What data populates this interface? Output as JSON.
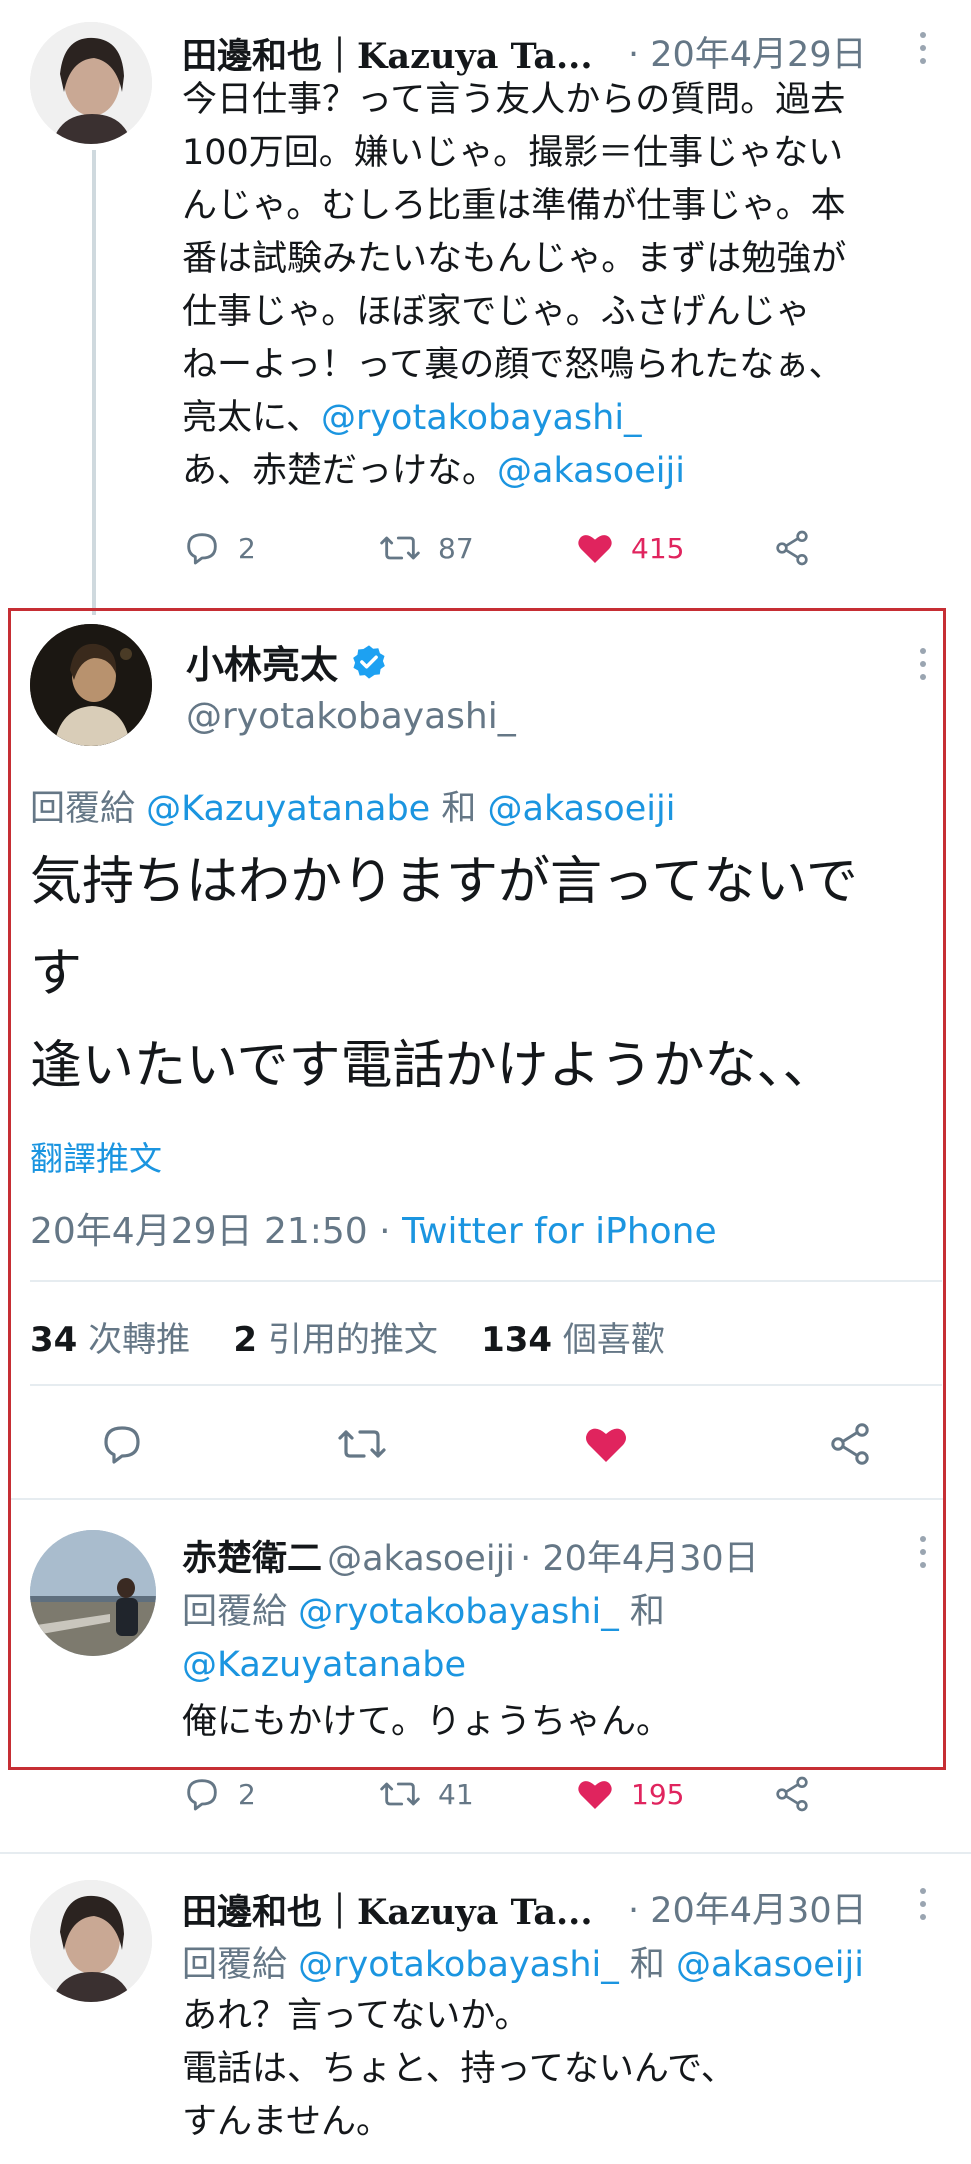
{
  "tweet1": {
    "name": "田邊和也｜Kazuya Ta...",
    "date": "· 20年4月29日",
    "lines": [
      "今日仕事？って言う友人からの質問。過去",
      "100万回。嫌いじゃ。撮影＝仕事じゃない",
      "んじゃ。むしろ比重は準備が仕事じゃ。本",
      "番は試験みたいなもんじゃ。まずは勉強が",
      "仕事じゃ。ほぼ家でじゃ。ふさげんじゃ",
      "ねーよっ！って裏の顔で怒鳴られたなぁ、"
    ],
    "line7_prefix": "亮太に、",
    "line7_mention": "@ryotakobayashi_",
    "line8_prefix": "あ、赤楚だっけな。",
    "line8_mention": "@akasoeiji",
    "reply_count": "2",
    "retweet_count": "87",
    "like_count": "415"
  },
  "main": {
    "name": "小林亮太",
    "handle": "@ryotakobayashi_",
    "reply_to_label": "回覆給",
    "reply_to_user1": "@Kazuyatanabe",
    "reply_to_and": "和",
    "reply_to_user2": "@akasoeiji",
    "text_line1": "気持ちはわかりますが言ってないで",
    "text_line2": "す",
    "text_line3": "逢いたいです電話かけようかな、、",
    "translate": "翻譯推文",
    "timestamp": "20年4月29日 21:50 ·",
    "source": "Twitter for iPhone",
    "retweets_num": "34",
    "retweets_label": "次轉推",
    "quotes_num": "2",
    "quotes_label": "引用的推文",
    "likes_num": "134",
    "likes_label": "個喜歡"
  },
  "tweet3": {
    "name": "赤楚衛二",
    "handle": "@akasoeiji",
    "date": "· 20年4月30日",
    "reply_to_label": "回覆給",
    "reply_to_user1": "@ryotakobayashi_",
    "reply_to_and": "和",
    "reply_to_user2": "@Kazuyatanabe",
    "text": "俺にもかけて。りょうちゃん。",
    "reply_count": "2",
    "retweet_count": "41",
    "like_count": "195"
  },
  "tweet4": {
    "name": "田邊和也｜Kazuya Ta...",
    "date": "· 20年4月30日",
    "reply_to_label": "回覆給",
    "reply_to_user1": "@ryotakobayashi_",
    "reply_to_and": "和",
    "reply_to_user2": "@akasoeiji",
    "lines": [
      "あれ？言ってないか。",
      "電話は、ちょと、持ってないんで、",
      "すんません。"
    ]
  },
  "colors": {
    "link": "#1b95e0",
    "like": "#e0245e",
    "highlight_border": "#c62e34",
    "verified": "#1da1f2"
  },
  "icons": [
    "reply-icon",
    "retweet-icon",
    "like-icon",
    "share-icon",
    "more-icon",
    "verified-icon"
  ]
}
